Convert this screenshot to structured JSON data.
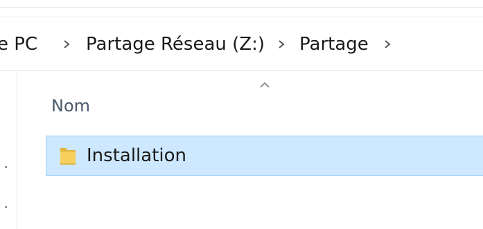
{
  "breadcrumb": {
    "items": [
      {
        "label": "e PC"
      },
      {
        "label": "Partage Réseau (Z:)"
      },
      {
        "label": "Partage"
      }
    ]
  },
  "file_list": {
    "column_header": "Nom",
    "sort_icon": "chevron-up-icon",
    "rows": [
      {
        "name": "Installation",
        "icon": "folder-icon",
        "selected": true
      }
    ]
  },
  "colors": {
    "selection_fill": "#cde8ff",
    "selection_border": "#99d1ff",
    "folder": "#f3c64a",
    "header_text": "#4c5a6a"
  }
}
